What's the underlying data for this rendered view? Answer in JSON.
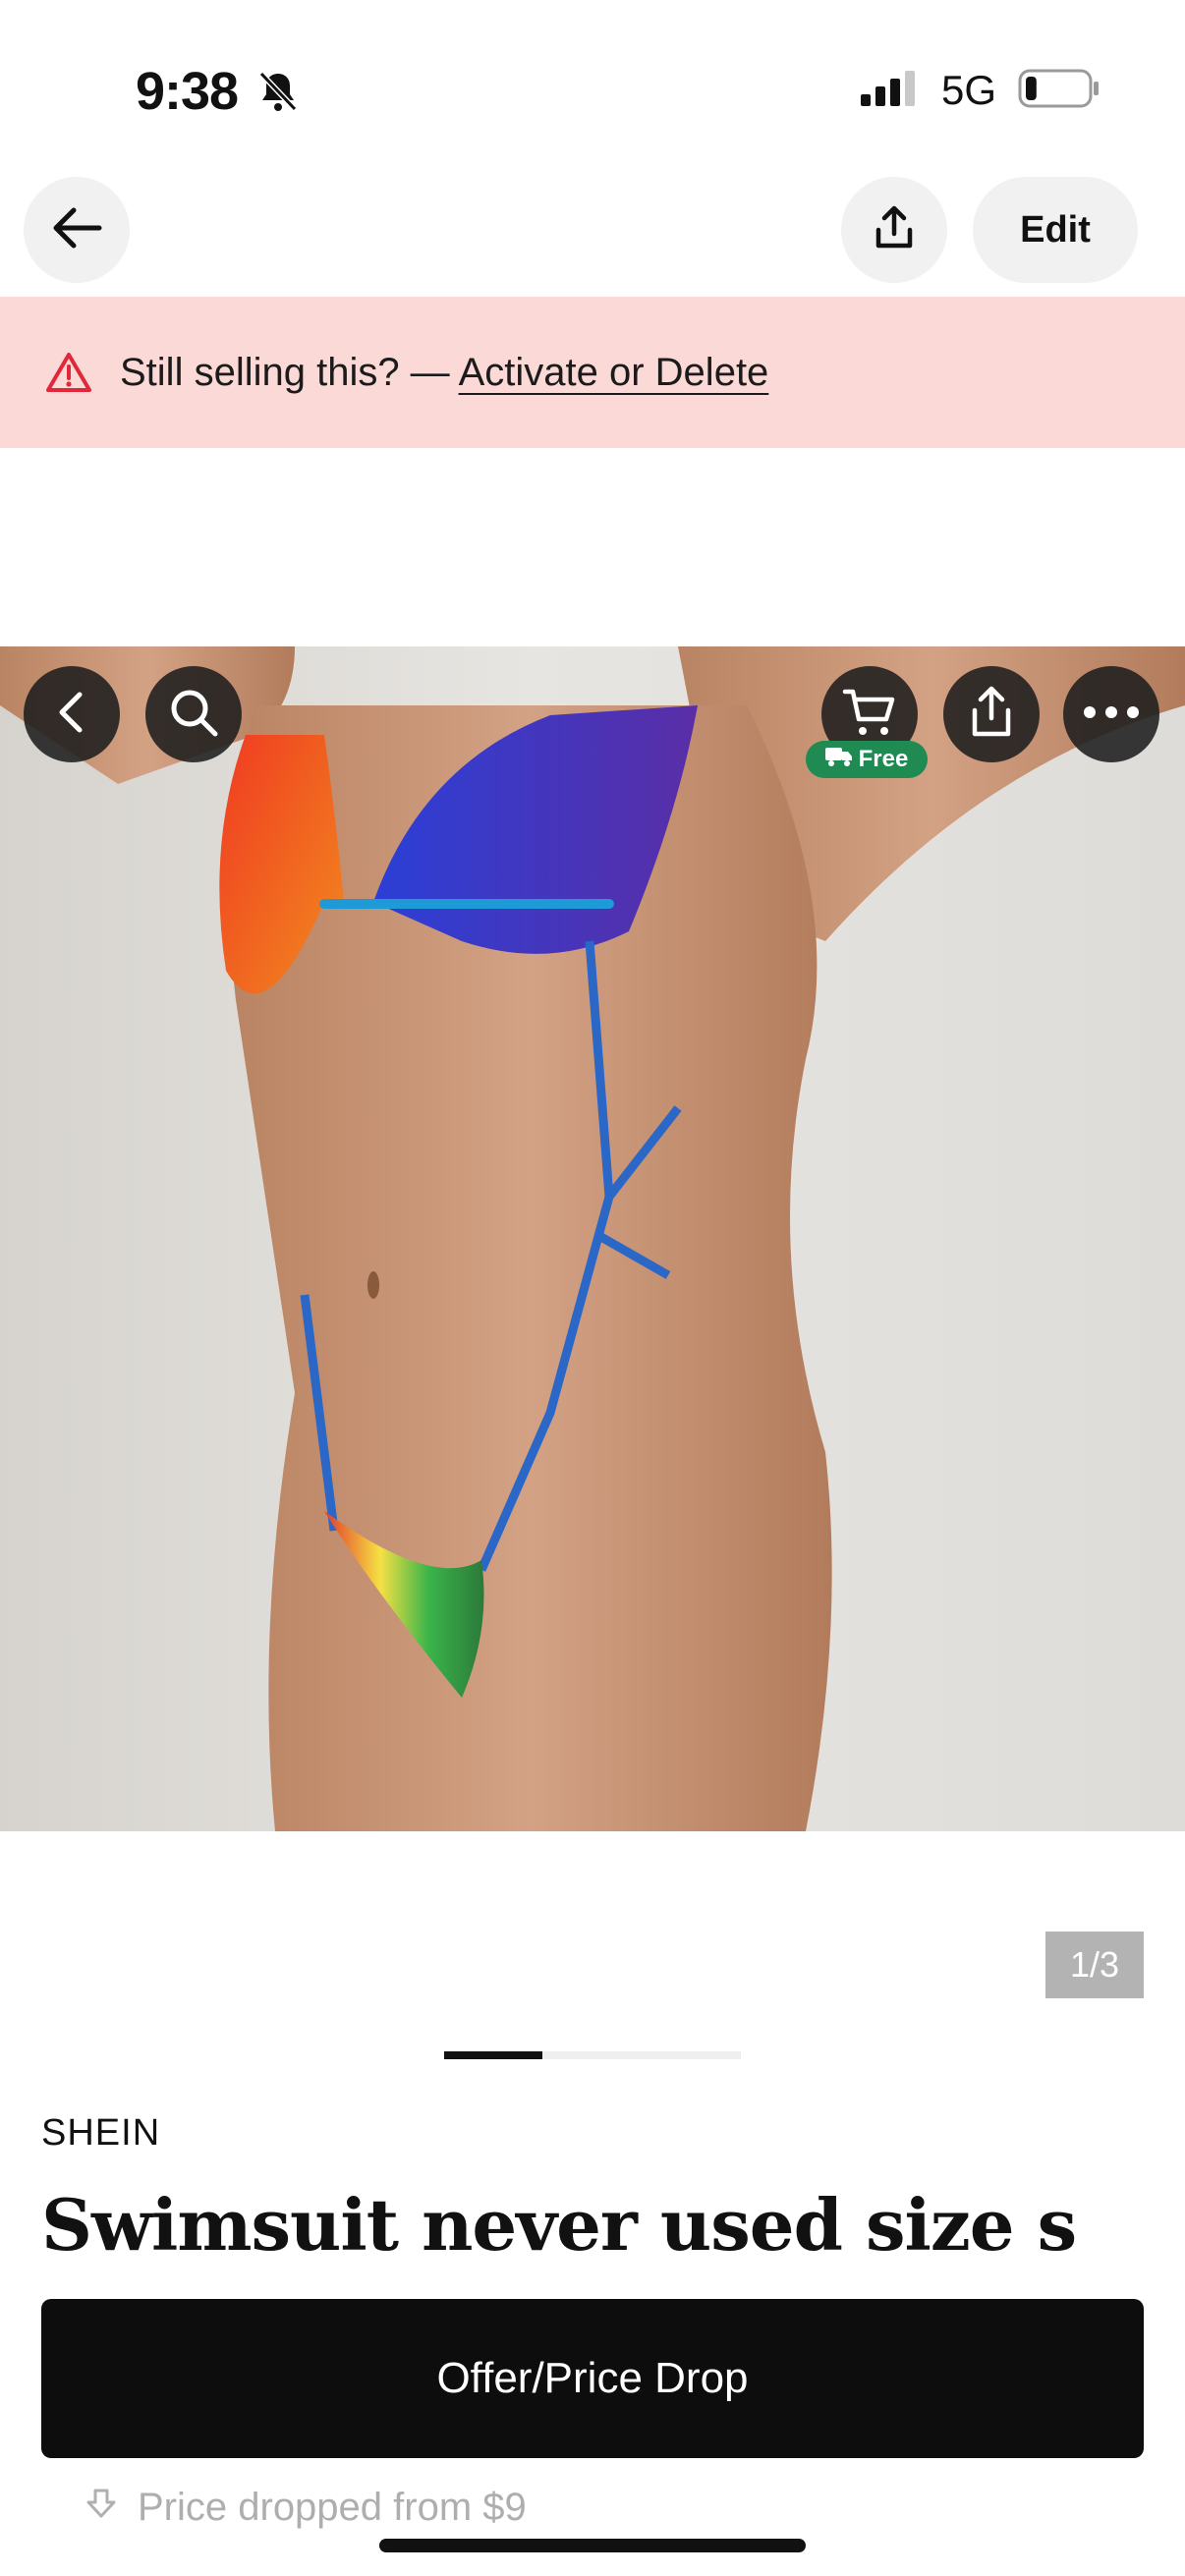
{
  "status_bar": {
    "time": "9:38",
    "network": "5G",
    "battery_level": 0.18
  },
  "banner": {
    "text": "Still selling this? — ",
    "link": "Activate or Delete"
  },
  "nav": {
    "edit_label": "Edit"
  },
  "photo": {
    "free_badge": "Free",
    "counter": "1/3",
    "progress": 0.33
  },
  "listing": {
    "brand": "SHEIN",
    "title": "Swimsuit never used size s",
    "offer_button": "Offer/Price Drop",
    "price_drop_text": "Price dropped from $9"
  },
  "colors": {
    "banner_bg": "#fbd9d7",
    "warning": "#e0283a",
    "primary_button": "#0d0d0d",
    "free_badge": "#1f8a52"
  }
}
